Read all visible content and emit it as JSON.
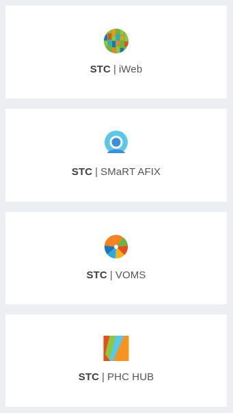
{
  "apps": [
    {
      "brand": "STC",
      "separator": "|",
      "name": "iWeb",
      "icon": "iweb-grid-icon"
    },
    {
      "brand": "STC",
      "separator": "|",
      "name": "SMaRT AFIX",
      "icon": "smart-afix-person-icon"
    },
    {
      "brand": "STC",
      "separator": "|",
      "name": "VOMS",
      "icon": "voms-pinwheel-icon"
    },
    {
      "brand": "STC",
      "separator": "|",
      "name": "PHC HUB",
      "icon": "phc-hub-square-icon"
    }
  ],
  "colors": {
    "background": "#ECEEF1",
    "card": "#FFFFFF",
    "text": "#4A4A4A"
  }
}
